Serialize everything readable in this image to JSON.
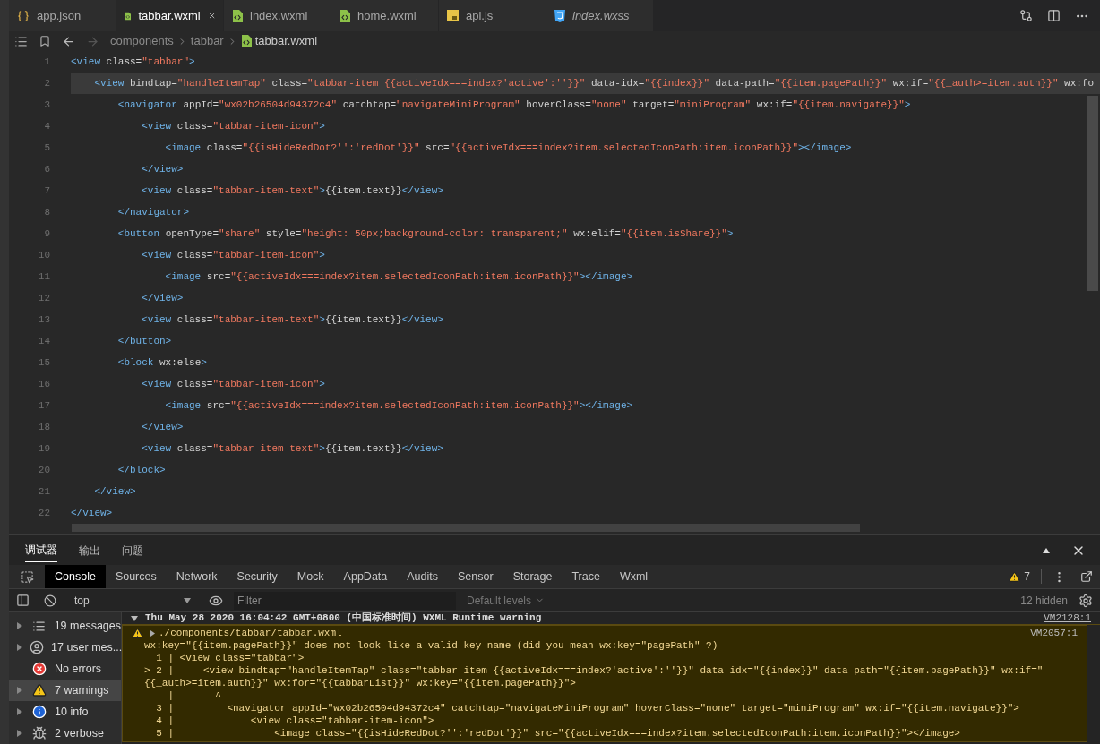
{
  "tabs": [
    {
      "label": "app.json",
      "kind": "json",
      "selected": false,
      "preview": false
    },
    {
      "label": "tabbar.wxml",
      "kind": "wxml",
      "selected": true,
      "preview": false
    },
    {
      "label": "index.wxml",
      "kind": "wxml",
      "selected": false,
      "preview": false
    },
    {
      "label": "home.wxml",
      "kind": "wxml",
      "selected": false,
      "preview": false
    },
    {
      "label": "api.js",
      "kind": "js",
      "selected": false,
      "preview": false
    },
    {
      "label": "index.wxss",
      "kind": "css",
      "selected": false,
      "preview": true
    }
  ],
  "breadcrumb": [
    "components",
    "tabbar",
    "tabbar.wxml"
  ],
  "editor": {
    "lines": [
      {
        "number": "1",
        "highlighted": false,
        "tokens": [
          {
            "kind": "tag",
            "text": "<view"
          },
          {
            "kind": "attr",
            "text": " class="
          },
          {
            "kind": "string",
            "text": "\"tabbar\""
          },
          {
            "kind": "tag",
            "text": ">"
          }
        ]
      },
      {
        "number": "2",
        "highlighted": true,
        "tokens": [
          {
            "kind": "tag",
            "text": "    <view"
          },
          {
            "kind": "attr",
            "text": " bindtap="
          },
          {
            "kind": "string",
            "text": "\"handleItemTap\""
          },
          {
            "kind": "attr",
            "text": " class="
          },
          {
            "kind": "string",
            "text": "\"tabbar-item {{activeIdx===index?'active':''}}\""
          },
          {
            "kind": "attr",
            "text": " data-idx="
          },
          {
            "kind": "string",
            "text": "\"{{index}}\""
          },
          {
            "kind": "attr",
            "text": " data-path="
          },
          {
            "kind": "string",
            "text": "\"{{item.pagePath}}\""
          },
          {
            "kind": "attr",
            "text": " wx:if="
          },
          {
            "kind": "string",
            "text": "\"{{_auth>=item.auth}}\""
          },
          {
            "kind": "attr",
            "text": " wx:fo"
          }
        ]
      },
      {
        "number": "3",
        "highlighted": false,
        "tokens": [
          {
            "kind": "tag",
            "text": "        <navigator"
          },
          {
            "kind": "attr",
            "text": " appId="
          },
          {
            "kind": "string",
            "text": "\"wx02b26504d94372c4\""
          },
          {
            "kind": "attr",
            "text": " catchtap="
          },
          {
            "kind": "string",
            "text": "\"navigateMiniProgram\""
          },
          {
            "kind": "attr",
            "text": " hoverClass="
          },
          {
            "kind": "string",
            "text": "\"none\""
          },
          {
            "kind": "attr",
            "text": " target="
          },
          {
            "kind": "string",
            "text": "\"miniProgram\""
          },
          {
            "kind": "attr",
            "text": " wx:if="
          },
          {
            "kind": "string",
            "text": "\"{{item.navigate}}\""
          },
          {
            "kind": "tag",
            "text": ">"
          }
        ]
      },
      {
        "number": "4",
        "highlighted": false,
        "tokens": [
          {
            "kind": "tag",
            "text": "            <view"
          },
          {
            "kind": "attr",
            "text": " class="
          },
          {
            "kind": "string",
            "text": "\"tabbar-item-icon\""
          },
          {
            "kind": "tag",
            "text": ">"
          }
        ]
      },
      {
        "number": "5",
        "highlighted": false,
        "tokens": [
          {
            "kind": "tag",
            "text": "                <image"
          },
          {
            "kind": "attr",
            "text": " class="
          },
          {
            "kind": "string",
            "text": "\"{{isHideRedDot?'':'redDot'}}\""
          },
          {
            "kind": "attr",
            "text": " src="
          },
          {
            "kind": "string",
            "text": "\"{{activeIdx===index?item.selectedIconPath:item.iconPath}}\""
          },
          {
            "kind": "tag",
            "text": "></image>"
          }
        ]
      },
      {
        "number": "6",
        "highlighted": false,
        "tokens": [
          {
            "kind": "tag",
            "text": "            </view>"
          }
        ]
      },
      {
        "number": "7",
        "highlighted": false,
        "tokens": [
          {
            "kind": "tag",
            "text": "            <view"
          },
          {
            "kind": "attr",
            "text": " class="
          },
          {
            "kind": "string",
            "text": "\"tabbar-item-text\""
          },
          {
            "kind": "tag",
            "text": ">"
          },
          {
            "kind": "text",
            "text": "{{item.text}}"
          },
          {
            "kind": "tag",
            "text": "</view>"
          }
        ]
      },
      {
        "number": "8",
        "highlighted": false,
        "tokens": [
          {
            "kind": "tag",
            "text": "        </navigator>"
          }
        ]
      },
      {
        "number": "9",
        "highlighted": false,
        "tokens": [
          {
            "kind": "tag",
            "text": "        <button"
          },
          {
            "kind": "attr",
            "text": " openType="
          },
          {
            "kind": "string",
            "text": "\"share\""
          },
          {
            "kind": "attr",
            "text": " style="
          },
          {
            "kind": "string",
            "text": "\"height: 50px;background-color: transparent;\""
          },
          {
            "kind": "attr",
            "text": " wx:elif="
          },
          {
            "kind": "string",
            "text": "\"{{item.isShare}}\""
          },
          {
            "kind": "tag",
            "text": ">"
          }
        ]
      },
      {
        "number": "10",
        "highlighted": false,
        "tokens": [
          {
            "kind": "tag",
            "text": "            <view"
          },
          {
            "kind": "attr",
            "text": " class="
          },
          {
            "kind": "string",
            "text": "\"tabbar-item-icon\""
          },
          {
            "kind": "tag",
            "text": ">"
          }
        ]
      },
      {
        "number": "11",
        "highlighted": false,
        "tokens": [
          {
            "kind": "tag",
            "text": "                <image"
          },
          {
            "kind": "attr",
            "text": " src="
          },
          {
            "kind": "string",
            "text": "\"{{activeIdx===index?item.selectedIconPath:item.iconPath}}\""
          },
          {
            "kind": "tag",
            "text": "></image>"
          }
        ]
      },
      {
        "number": "12",
        "highlighted": false,
        "tokens": [
          {
            "kind": "tag",
            "text": "            </view>"
          }
        ]
      },
      {
        "number": "13",
        "highlighted": false,
        "tokens": [
          {
            "kind": "tag",
            "text": "            <view"
          },
          {
            "kind": "attr",
            "text": " class="
          },
          {
            "kind": "string",
            "text": "\"tabbar-item-text\""
          },
          {
            "kind": "tag",
            "text": ">"
          },
          {
            "kind": "text",
            "text": "{{item.text}}"
          },
          {
            "kind": "tag",
            "text": "</view>"
          }
        ]
      },
      {
        "number": "14",
        "highlighted": false,
        "tokens": [
          {
            "kind": "tag",
            "text": "        </button>"
          }
        ]
      },
      {
        "number": "15",
        "highlighted": false,
        "tokens": [
          {
            "kind": "tag",
            "text": "        <block"
          },
          {
            "kind": "attr",
            "text": " wx:else"
          },
          {
            "kind": "tag",
            "text": ">"
          }
        ]
      },
      {
        "number": "16",
        "highlighted": false,
        "tokens": [
          {
            "kind": "tag",
            "text": "            <view"
          },
          {
            "kind": "attr",
            "text": " class="
          },
          {
            "kind": "string",
            "text": "\"tabbar-item-icon\""
          },
          {
            "kind": "tag",
            "text": ">"
          }
        ]
      },
      {
        "number": "17",
        "highlighted": false,
        "tokens": [
          {
            "kind": "tag",
            "text": "                <image"
          },
          {
            "kind": "attr",
            "text": " src="
          },
          {
            "kind": "string",
            "text": "\"{{activeIdx===index?item.selectedIconPath:item.iconPath}}\""
          },
          {
            "kind": "tag",
            "text": "></image>"
          }
        ]
      },
      {
        "number": "18",
        "highlighted": false,
        "tokens": [
          {
            "kind": "tag",
            "text": "            </view>"
          }
        ]
      },
      {
        "number": "19",
        "highlighted": false,
        "tokens": [
          {
            "kind": "tag",
            "text": "            <view"
          },
          {
            "kind": "attr",
            "text": " class="
          },
          {
            "kind": "string",
            "text": "\"tabbar-item-text\""
          },
          {
            "kind": "tag",
            "text": ">"
          },
          {
            "kind": "text",
            "text": "{{item.text}}"
          },
          {
            "kind": "tag",
            "text": "</view>"
          }
        ]
      },
      {
        "number": "20",
        "highlighted": false,
        "tokens": [
          {
            "kind": "tag",
            "text": "        </block>"
          }
        ]
      },
      {
        "number": "21",
        "highlighted": false,
        "tokens": [
          {
            "kind": "tag",
            "text": "    </view>"
          }
        ]
      },
      {
        "number": "22",
        "highlighted": false,
        "tokens": [
          {
            "kind": "tag",
            "text": "</view>"
          }
        ]
      }
    ]
  },
  "panel_tabs": [
    {
      "label": "调试器",
      "selected": true
    },
    {
      "label": "输出",
      "selected": false
    },
    {
      "label": "问题",
      "selected": false
    }
  ],
  "devtools": {
    "tabs": [
      {
        "label": "Console",
        "selected": true
      },
      {
        "label": "Sources",
        "selected": false
      },
      {
        "label": "Network",
        "selected": false
      },
      {
        "label": "Security",
        "selected": false
      },
      {
        "label": "Mock",
        "selected": false
      },
      {
        "label": "AppData",
        "selected": false
      },
      {
        "label": "Audits",
        "selected": false
      },
      {
        "label": "Sensor",
        "selected": false
      },
      {
        "label": "Storage",
        "selected": false
      },
      {
        "label": "Trace",
        "selected": false
      },
      {
        "label": "Wxml",
        "selected": false
      }
    ],
    "warning_count": "7"
  },
  "filter": {
    "context": "top",
    "placeholder": "Filter",
    "levels": "Default levels",
    "hidden": "12 hidden"
  },
  "sidebar": [
    {
      "kind": "messages",
      "label": "19 messages",
      "selected": false
    },
    {
      "kind": "user",
      "label": "17 user mes...",
      "selected": false
    },
    {
      "kind": "errors",
      "label": "No errors",
      "selected": false
    },
    {
      "kind": "warnings",
      "label": "7 warnings",
      "selected": true
    },
    {
      "kind": "info",
      "label": "10 info",
      "selected": false
    },
    {
      "kind": "verbose",
      "label": "2 verbose",
      "selected": false
    }
  ],
  "messages": [
    {
      "kind": "group",
      "text": "Thu May 28 2020 16:04:42 GMT+0800 (中国标准时间) WXML Runtime warning",
      "source": "VM2128:1"
    },
    {
      "kind": "warning",
      "title": "./components/tabbar/tabbar.wxml",
      "source": "VM2057:1",
      "lines": [
        "wx:key=\"{{item.pagePath}}\" does not look like a valid key name (did you mean wx:key=\"pagePath\" ?)",
        "  1 | <view class=\"tabbar\">",
        "> 2 |     <view bindtap=\"handleItemTap\" class=\"tabbar-item {{activeIdx===index?'active':''}}\" data-idx=\"{{index}}\" data-path=\"{{item.pagePath}}\" wx:if=\"",
        "{{_auth>=item.auth}}\" wx:for=\"{{tabbarList}}\" wx:key=\"{{item.pagePath}}\">",
        "    |       ^",
        "  3 |         <navigator appId=\"wx02b26504d94372c4\" catchtap=\"navigateMiniProgram\" hoverClass=\"none\" target=\"miniProgram\" wx:if=\"{{item.navigate}}\">",
        "  4 |             <view class=\"tabbar-item-icon\">",
        "  5 |                 <image class=\"{{isHideRedDot?'':'redDot'}}\" src=\"{{activeIdx===index?item.selectedIconPath:item.iconPath}}\"></image>"
      ]
    }
  ]
}
